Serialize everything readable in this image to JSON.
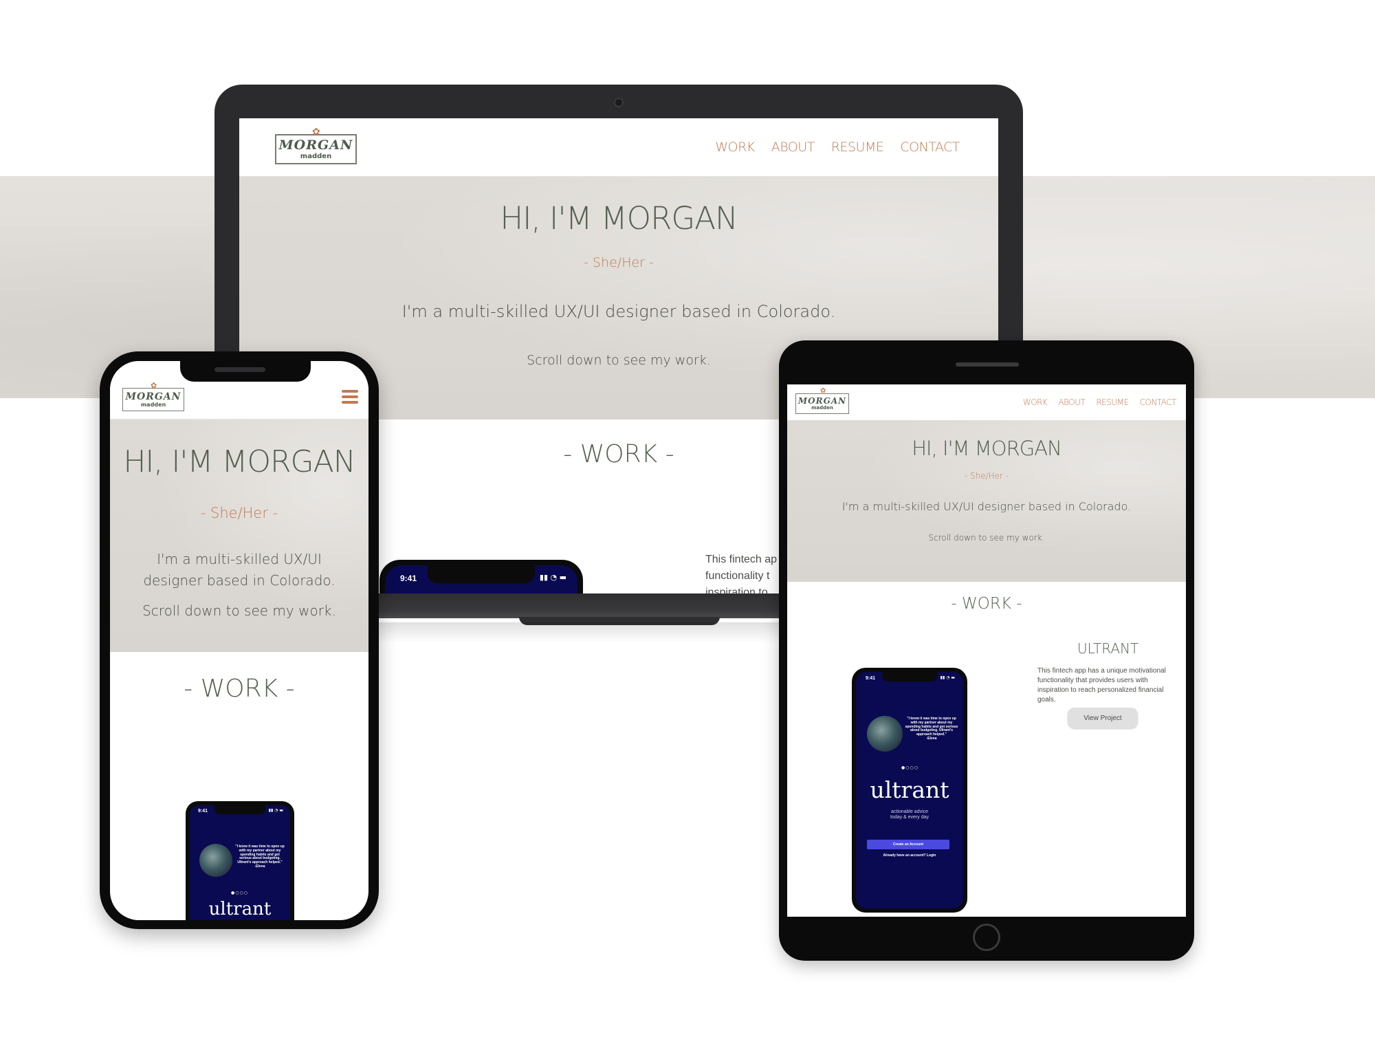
{
  "site": {
    "logo_main": "MORGAN",
    "logo_sub": "madden",
    "nav": [
      "WORK",
      "ABOUT",
      "RESUME",
      "CONTACT"
    ],
    "hero_title": "HI, I'M MORGAN",
    "pronouns": "- She/Her -",
    "intro": "I'm a multi-skilled UX/UI designer based in Colorado.",
    "scroll_hint": "Scroll down to see my work.",
    "work_heading": "- WORK -"
  },
  "laptop": {
    "desc_lines": [
      "This fintech ap",
      "functionality t",
      "inspiration to"
    ],
    "phone_time": "9:41"
  },
  "project": {
    "title": "ULTRANT",
    "description": "This fintech app has a unique motivational functionality that provides users with inspiration to reach personalized financial goals.",
    "button": "View Project"
  },
  "ultrant_app": {
    "time": "9:41",
    "quote": "\"I knew it was time to open up with my partner about my spending habits and get serious about budgeting. Ultrant's approach helped.\"",
    "quote_author": "-Elena",
    "dots": "●○○○",
    "brand": "ultrant",
    "tagline_1": "actionable advice",
    "tagline_2": "today & every day",
    "cta": "Create an Account",
    "login": "Already have an account? Login"
  },
  "colors": {
    "accent": "#c07a52",
    "heading": "#55604f",
    "app_bg": "#0a0a52"
  }
}
